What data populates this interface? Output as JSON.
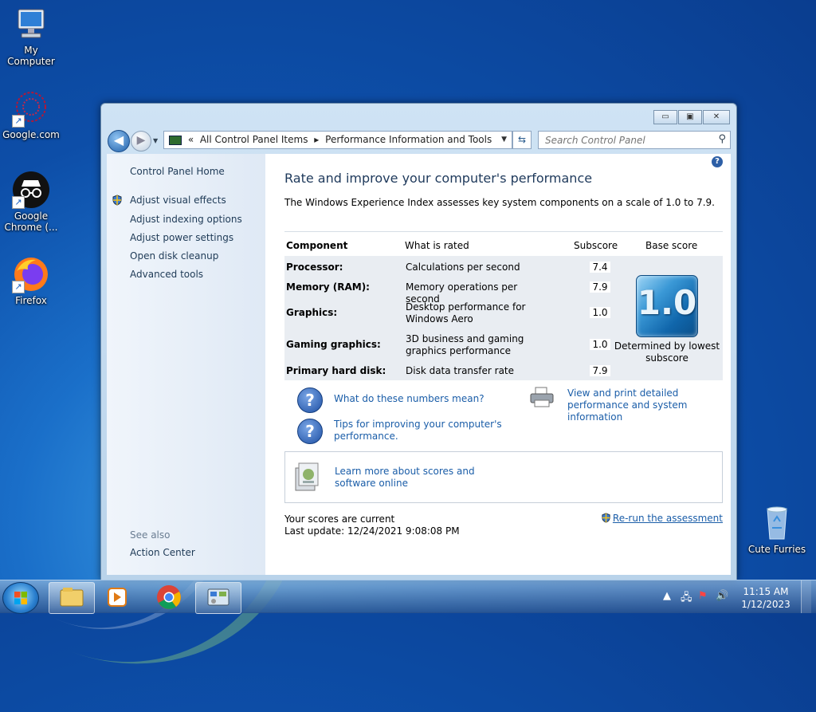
{
  "desktop": {
    "icons": [
      {
        "label": "My Computer",
        "icon": "computer-icon"
      },
      {
        "label": "Google.com",
        "icon": "web-shortcut-icon"
      },
      {
        "label": "Google Chrome (...",
        "icon": "chrome-incognito-icon"
      },
      {
        "label": "Firefox",
        "icon": "firefox-icon"
      },
      {
        "label": "Cute Furries",
        "icon": "recycle-bin-icon"
      }
    ]
  },
  "window": {
    "address": {
      "sep": "«",
      "crumb1": "All Control Panel Items",
      "arrow": "▸",
      "crumb2": "Performance Information and Tools"
    },
    "search_placeholder": "Search Control Panel",
    "caption": {
      "minimize": "▭",
      "maximize": "▣",
      "close": "✕"
    }
  },
  "sidebar": {
    "home": "Control Panel Home",
    "tasks": [
      "Adjust visual effects",
      "Adjust indexing options",
      "Adjust power settings",
      "Open disk cleanup",
      "Advanced tools"
    ],
    "see_also": "See also",
    "see_also_links": [
      "Action Center"
    ]
  },
  "main": {
    "title": "Rate and improve your computer's performance",
    "intro": "The Windows Experience Index assesses key system components on a scale of 1.0 to 7.9.",
    "table": {
      "headers": {
        "component": "Component",
        "what": "What is rated",
        "subscore": "Subscore",
        "base": "Base score"
      },
      "rows": [
        {
          "component": "Processor:",
          "what": "Calculations per second",
          "subscore": "7.4"
        },
        {
          "component": "Memory (RAM):",
          "what": "Memory operations per second",
          "subscore": "7.9"
        },
        {
          "component": "Graphics:",
          "what": "Desktop performance for Windows Aero",
          "subscore": "1.0"
        },
        {
          "component": "Gaming graphics:",
          "what": "3D business and gaming graphics performance",
          "subscore": "1.0"
        },
        {
          "component": "Primary hard disk:",
          "what": "Disk data transfer rate",
          "subscore": "7.9"
        }
      ],
      "base_score": "1.0",
      "base_note": "Determined by lowest subscore"
    },
    "links": {
      "numbers": "What do these numbers mean?",
      "tips": "Tips for improving your computer's performance.",
      "print": "View and print detailed performance and system information",
      "learn": "Learn more about scores and software online"
    },
    "status": {
      "current": "Your scores are current",
      "last_update": "Last update: 12/24/2021 9:08:08 PM",
      "rerun": "Re-run the assessment"
    }
  },
  "taskbar": {
    "clock_time": "11:15 AM",
    "clock_date": "1/12/2023"
  }
}
